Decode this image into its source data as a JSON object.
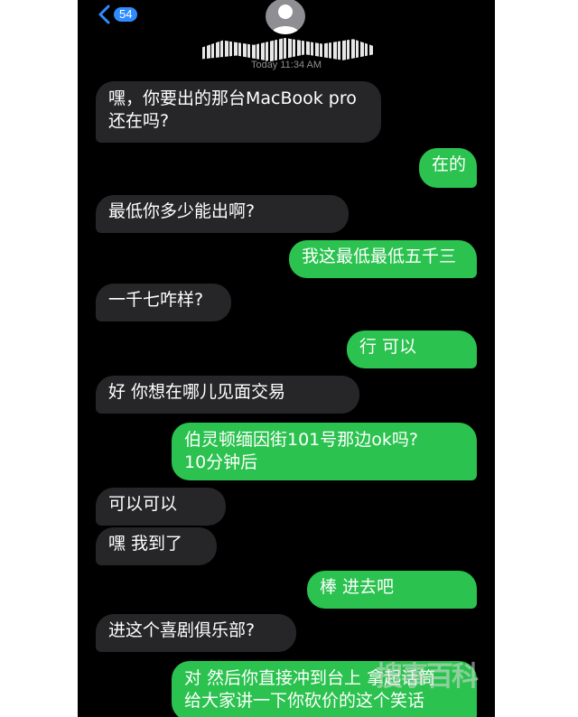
{
  "header": {
    "back_badge": "54",
    "timestamp": "Today 11:34 AM"
  },
  "messages": [
    {
      "side": "in",
      "text": "嘿，你要出的那台MacBook pro\n还在吗?"
    },
    {
      "side": "out",
      "text": "在的"
    },
    {
      "side": "in",
      "text": "最低你多少能出啊?"
    },
    {
      "side": "out",
      "text": "我这最低最低五千三"
    },
    {
      "side": "in",
      "text": "一千七咋样?"
    },
    {
      "side": "out",
      "text": "行 可以"
    },
    {
      "side": "in",
      "text": "好 你想在哪儿见面交易"
    },
    {
      "side": "out",
      "text": "伯灵顿缅因街101号那边ok吗?\n10分钟后"
    },
    {
      "side": "in",
      "text": "可以可以"
    },
    {
      "side": "in",
      "text": "嘿 我到了"
    },
    {
      "side": "out",
      "text": "棒 进去吧"
    },
    {
      "side": "in",
      "text": "进这个喜剧俱乐部?"
    },
    {
      "side": "out",
      "text": "对 然后你直接冲到台上 拿起话筒\n给大家讲一下你砍价的这个笑话"
    }
  ],
  "watermark": "搜事百科",
  "colors": {
    "incoming_bubble": "#262629",
    "outgoing_bubble": "#2bc24f",
    "badge": "#2f8cff",
    "background": "#000000"
  },
  "icons": {
    "back": "chevron-left-icon",
    "avatar": "person-silhouette-icon"
  }
}
